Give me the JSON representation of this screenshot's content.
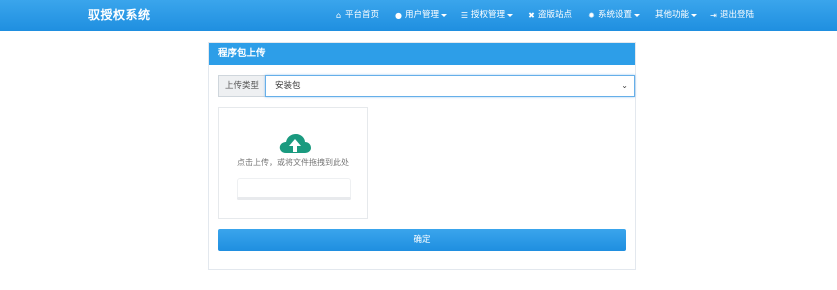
{
  "navbar": {
    "brand": "驭授权系统",
    "items": [
      {
        "icon": "home-icon",
        "glyph": "⌂",
        "label": "平台首页",
        "dropdown": false
      },
      {
        "icon": "user-icon",
        "glyph": "●",
        "label": "用户管理",
        "dropdown": true
      },
      {
        "icon": "list-icon",
        "glyph": "☰",
        "label": "授权管理",
        "dropdown": true
      },
      {
        "icon": "close-icon",
        "glyph": "✖",
        "label": "盗版站点",
        "dropdown": false
      },
      {
        "icon": "gear-icon",
        "glyph": "✹",
        "label": "系统设置",
        "dropdown": true
      },
      {
        "icon": "",
        "glyph": "",
        "label": "其他功能",
        "dropdown": true
      },
      {
        "icon": "logout-icon",
        "glyph": "⇥",
        "label": "退出登陆",
        "dropdown": false
      }
    ]
  },
  "panel": {
    "title": "程序包上传",
    "type_label": "上传类型",
    "type_value": "安装包",
    "upload_hint": "点击上传，或将文件拖拽到此处",
    "confirm_label": "确定"
  },
  "colors": {
    "primary": "#2d9ee8",
    "cloud": "#1a9a7f"
  }
}
